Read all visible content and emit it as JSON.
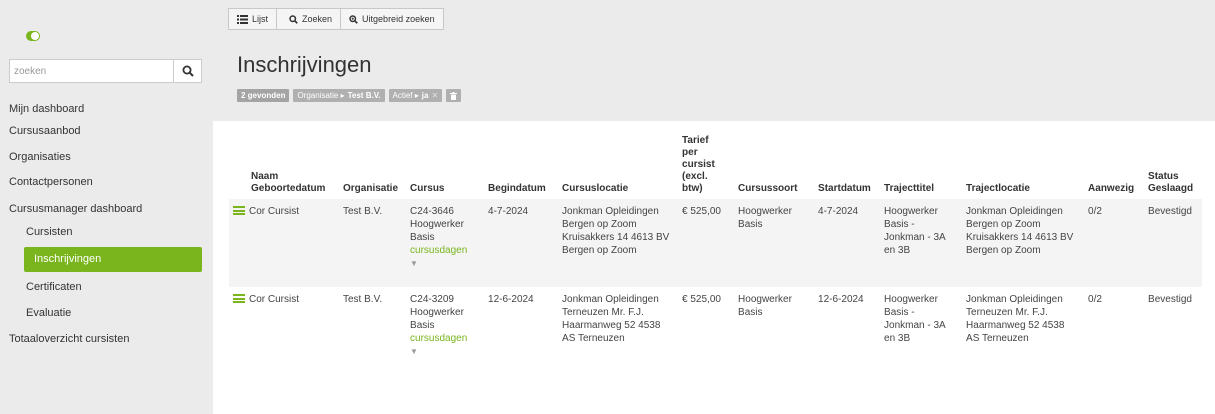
{
  "sidebar": {
    "search_placeholder": "zoeken",
    "items": [
      {
        "label": "Mijn dashboard"
      },
      {
        "label": "Cursusaanbod"
      },
      {
        "label": "Organisaties"
      },
      {
        "label": "Contactpersonen"
      },
      {
        "label": "Cursusmanager dashboard"
      },
      {
        "label": "Cursisten"
      },
      {
        "label": "Inschrijvingen"
      },
      {
        "label": "Certificaten"
      },
      {
        "label": "Evaluatie"
      },
      {
        "label": "Totaaloverzicht cursisten"
      }
    ]
  },
  "toolbar": {
    "list_label": "Lijst",
    "search_label": "Zoeken",
    "advanced_label": "Uitgebreid zoeken"
  },
  "page": {
    "title": "Inschrijvingen"
  },
  "filters": {
    "count": "2 gevonden",
    "org_key": "Organisatie ▸",
    "org_value": "Test B.V.",
    "active_key": "Actief ▸",
    "active_value": "ja",
    "remove_symbol": "✕"
  },
  "table": {
    "headers": {
      "naam": "Naam",
      "geboortedatum": "Geboortedatum",
      "organisatie": "Organisatie",
      "cursus": "Cursus",
      "begindatum": "Begindatum",
      "cursuslocatie": "Cursuslocatie",
      "tarief": "Tarief per cursist (excl. btw)",
      "cursussoort": "Cursussoort",
      "startdatum": "Startdatum",
      "trajecttitel": "Trajecttitel",
      "trajectlocatie": "Trajectlocatie",
      "aanwezig": "Aanwezig",
      "status": "Status",
      "geslaagd": "Geslaagd"
    },
    "rows": [
      {
        "naam": "Cor Cursist",
        "organisatie": "Test B.V.",
        "cursus_code": "C24-3646",
        "cursus_name": "Hoogwerker Basis",
        "cursus_link": "cursusdagen",
        "begindatum": "4-7-2024",
        "cursuslocatie": "Jonkman Opleidingen Bergen op Zoom Kruisakkers 14 4613 BV Bergen op Zoom",
        "tarief": "€ 525,00",
        "cursussoort": "Hoogwerker Basis",
        "startdatum": "4-7-2024",
        "trajecttitel": "Hoogwerker Basis - Jonkman - 3A en 3B",
        "trajectlocatie": "Jonkman Opleidingen Bergen op Zoom Kruisakkers 14 4613 BV Bergen op Zoom",
        "aanwezig": "0/2",
        "status": "Bevestigd"
      },
      {
        "naam": "Cor Cursist",
        "organisatie": "Test B.V.",
        "cursus_code": "C24-3209",
        "cursus_name": "Hoogwerker Basis",
        "cursus_link": "cursusdagen",
        "begindatum": "12-6-2024",
        "cursuslocatie": "Jonkman Opleidingen Terneuzen Mr. F.J. Haarmanweg 52 4538 AS Terneuzen",
        "tarief": "€ 525,00",
        "cursussoort": "Hoogwerker Basis",
        "startdatum": "12-6-2024",
        "trajecttitel": "Hoogwerker Basis - Jonkman - 3A en 3B",
        "trajectlocatie": "Jonkman Opleidingen Terneuzen Mr. F.J. Haarmanweg 52 4538 AS Terneuzen",
        "aanwezig": "0/2",
        "status": "Bevestigd"
      }
    ]
  },
  "colors": {
    "accent": "#7ab51d",
    "background": "#ebebeb"
  },
  "icons": {
    "logo": "toggle-icon",
    "search": "search-icon",
    "list": "list-icon",
    "zoom": "zoom-icon",
    "trash": "trash-icon",
    "menu": "menu-icon",
    "caret": "caret-down-icon"
  }
}
